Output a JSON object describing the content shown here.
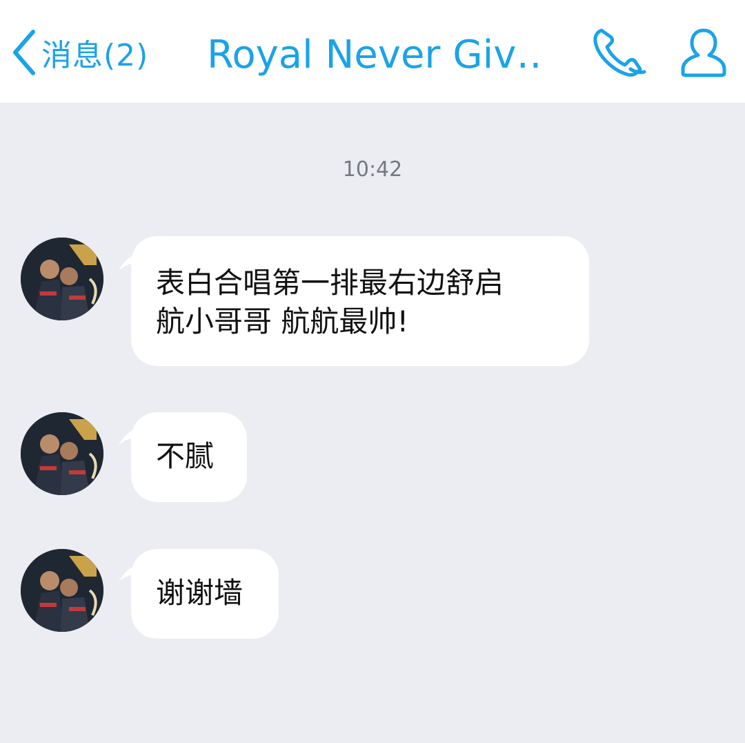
{
  "header": {
    "back_label": "消息(2)",
    "title": "Royal Never Giv…",
    "back_icon": "chevron-left-icon",
    "call_icon": "phone-icon",
    "profile_icon": "user-profile-icon",
    "accent_color": "#1aa3e8"
  },
  "chat": {
    "timestamp": "10:42",
    "messages": [
      {
        "line1": "表白合唱第一排最右边舒启",
        "line2": "航小哥哥 航航最帅!"
      },
      {
        "line1": "不腻"
      },
      {
        "line1": "谢谢墙"
      }
    ]
  }
}
